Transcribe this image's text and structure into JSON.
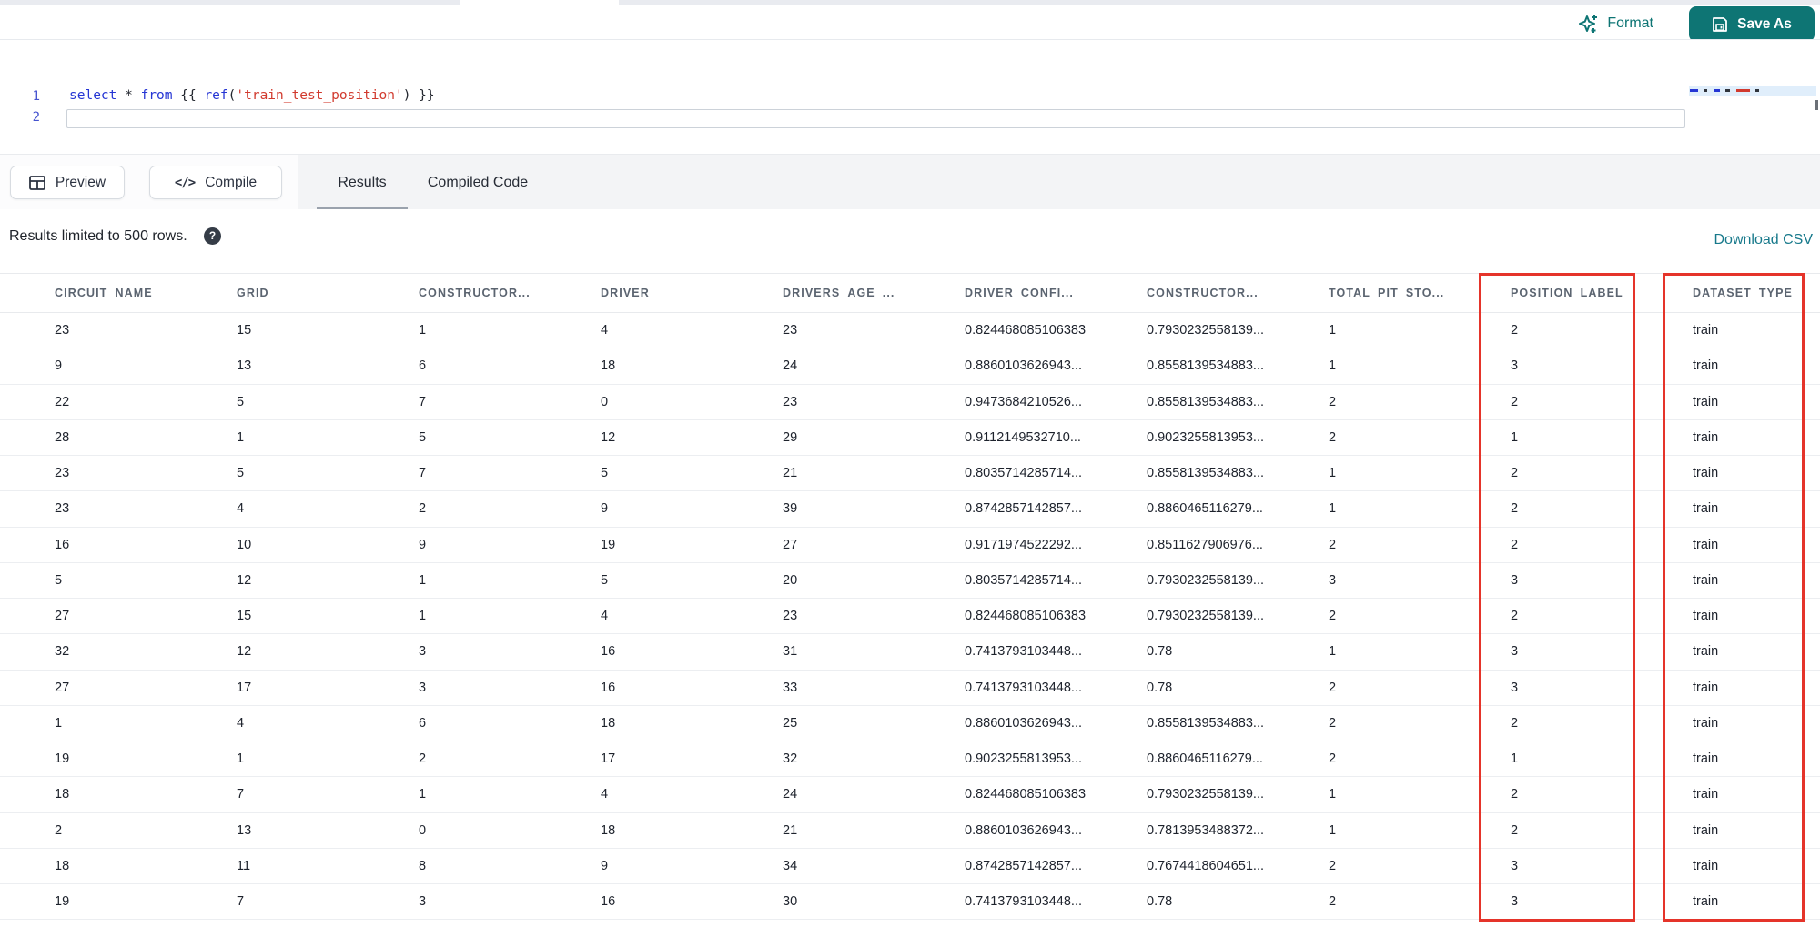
{
  "header": {
    "format_label": "Format",
    "save_as_label": "Save As",
    "format_icon": "sparkles-icon",
    "save_icon": "floppy-disk-icon"
  },
  "editor": {
    "line_numbers": [
      "1",
      "2"
    ],
    "code_lines": [
      {
        "tokens": [
          {
            "text": "select",
            "type": "keyword"
          },
          {
            "text": " ",
            "type": "plain"
          },
          {
            "text": "*",
            "type": "operator"
          },
          {
            "text": " ",
            "type": "plain"
          },
          {
            "text": "from",
            "type": "keyword"
          },
          {
            "text": " {{ ",
            "type": "plain"
          },
          {
            "text": "ref",
            "type": "function"
          },
          {
            "text": "(",
            "type": "plain"
          },
          {
            "text": "'train_test_position'",
            "type": "string"
          },
          {
            "text": ")",
            "type": "plain"
          },
          {
            "text": " }}",
            "type": "plain"
          }
        ]
      }
    ],
    "minimap_icon": "code-minimap"
  },
  "toolbar": {
    "preview_label": "Preview",
    "preview_icon": "table-icon",
    "compile_label": "Compile",
    "compile_icon_glyph": "</>",
    "tabs": [
      {
        "label": "Results",
        "active": true
      },
      {
        "label": "Compiled Code",
        "active": false
      }
    ]
  },
  "results_bar": {
    "limit_text": "Results limited to 500 rows.",
    "help_icon_glyph": "?",
    "download_label": "Download CSV"
  },
  "table": {
    "columns": [
      "CIRCUIT_NAME",
      "GRID",
      "CONSTRUCTOR...",
      "DRIVER",
      "DRIVERS_AGE_...",
      "DRIVER_CONFI...",
      "CONSTRUCTOR...",
      "TOTAL_PIT_STO...",
      "POSITION_LABEL",
      "DATASET_TYPE"
    ],
    "highlighted_columns": [
      "POSITION_LABEL",
      "DATASET_TYPE"
    ],
    "rows": [
      [
        "23",
        "15",
        "1",
        "4",
        "23",
        "0.824468085106383",
        "0.7930232558139...",
        "1",
        "2",
        "train"
      ],
      [
        "9",
        "13",
        "6",
        "18",
        "24",
        "0.8860103626943...",
        "0.8558139534883...",
        "1",
        "3",
        "train"
      ],
      [
        "22",
        "5",
        "7",
        "0",
        "23",
        "0.9473684210526...",
        "0.8558139534883...",
        "2",
        "2",
        "train"
      ],
      [
        "28",
        "1",
        "5",
        "12",
        "29",
        "0.9112149532710...",
        "0.9023255813953...",
        "2",
        "1",
        "train"
      ],
      [
        "23",
        "5",
        "7",
        "5",
        "21",
        "0.8035714285714...",
        "0.8558139534883...",
        "1",
        "2",
        "train"
      ],
      [
        "23",
        "4",
        "2",
        "9",
        "39",
        "0.8742857142857...",
        "0.8860465116279...",
        "1",
        "2",
        "train"
      ],
      [
        "16",
        "10",
        "9",
        "19",
        "27",
        "0.9171974522292...",
        "0.8511627906976...",
        "2",
        "2",
        "train"
      ],
      [
        "5",
        "12",
        "1",
        "5",
        "20",
        "0.8035714285714...",
        "0.7930232558139...",
        "3",
        "3",
        "train"
      ],
      [
        "27",
        "15",
        "1",
        "4",
        "23",
        "0.824468085106383",
        "0.7930232558139...",
        "2",
        "2",
        "train"
      ],
      [
        "32",
        "12",
        "3",
        "16",
        "31",
        "0.7413793103448...",
        "0.78",
        "1",
        "3",
        "train"
      ],
      [
        "27",
        "17",
        "3",
        "16",
        "33",
        "0.7413793103448...",
        "0.78",
        "2",
        "3",
        "train"
      ],
      [
        "1",
        "4",
        "6",
        "18",
        "25",
        "0.8860103626943...",
        "0.8558139534883...",
        "2",
        "2",
        "train"
      ],
      [
        "19",
        "1",
        "2",
        "17",
        "32",
        "0.9023255813953...",
        "0.8860465116279...",
        "2",
        "1",
        "train"
      ],
      [
        "18",
        "7",
        "1",
        "4",
        "24",
        "0.824468085106383",
        "0.7930232558139...",
        "1",
        "2",
        "train"
      ],
      [
        "2",
        "13",
        "0",
        "18",
        "21",
        "0.8860103626943...",
        "0.7813953488372...",
        "1",
        "2",
        "train"
      ],
      [
        "18",
        "11",
        "8",
        "9",
        "34",
        "0.8742857142857...",
        "0.7674418604651...",
        "2",
        "3",
        "train"
      ],
      [
        "19",
        "7",
        "3",
        "16",
        "30",
        "0.7413793103448...",
        "0.78",
        "2",
        "3",
        "train"
      ]
    ]
  },
  "colors": {
    "accent_teal": "#0e7574",
    "link_teal": "#17798b",
    "highlight_red": "#e5342a",
    "syntax_keyword": "#2636d4",
    "syntax_string": "#d13a2e",
    "header_text": "#5b6470",
    "tab_underline": "#9aa2ad"
  }
}
